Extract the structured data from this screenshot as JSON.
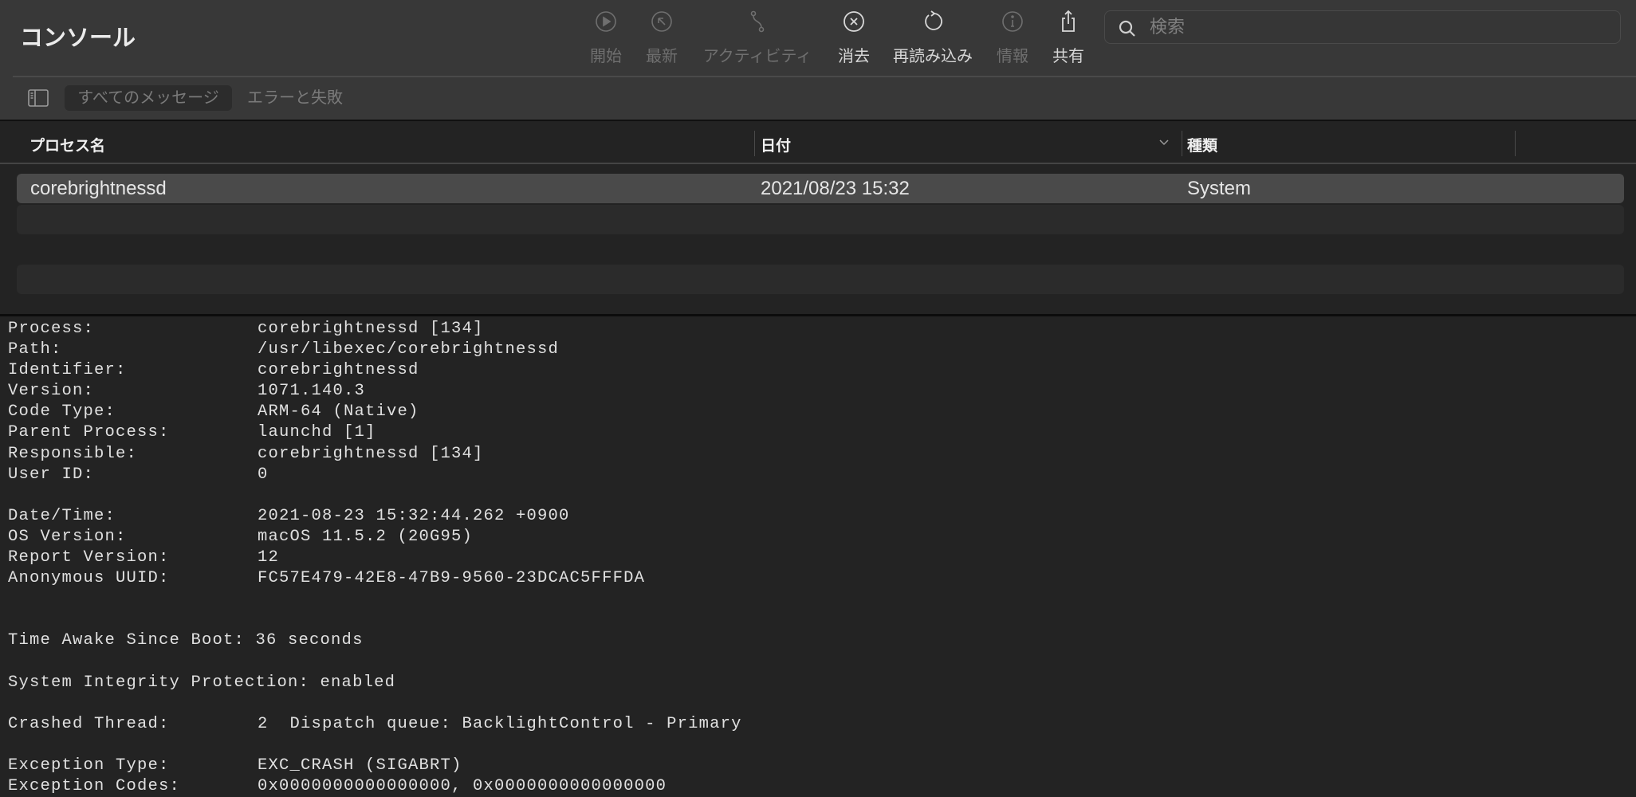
{
  "window": {
    "title": "コンソール"
  },
  "toolbar": {
    "buttons": [
      {
        "label": "開始",
        "icon": "play-circle-icon",
        "enabled": false
      },
      {
        "label": "最新",
        "icon": "arrow-up-left-circle-icon",
        "enabled": false
      },
      {
        "label": "アクティビティ",
        "icon": "activity-icon",
        "enabled": false
      },
      {
        "label": "消去",
        "icon": "clear-x-circle-icon",
        "enabled": true
      },
      {
        "label": "再読み込み",
        "icon": "reload-icon",
        "enabled": true
      },
      {
        "label": "情報",
        "icon": "info-icon",
        "enabled": false
      },
      {
        "label": "共有",
        "icon": "share-icon",
        "enabled": true
      }
    ],
    "search": {
      "placeholder": "検索",
      "value": ""
    }
  },
  "filters": {
    "all_messages": "すべてのメッセージ",
    "errors_faults": "エラーと失敗"
  },
  "table": {
    "columns": [
      "プロセス名",
      "日付",
      "種類"
    ],
    "rows": [
      {
        "process": "corebrightnessd",
        "date": "2021/08/23 15:32",
        "type": "System"
      }
    ]
  },
  "detail": {
    "lines": [
      {
        "k": "Process:",
        "v": "corebrightnessd [134]"
      },
      {
        "k": "Path:",
        "v": "/usr/libexec/corebrightnessd"
      },
      {
        "k": "Identifier:",
        "v": "corebrightnessd"
      },
      {
        "k": "Version:",
        "v": "1071.140.3"
      },
      {
        "k": "Code Type:",
        "v": "ARM-64 (Native)"
      },
      {
        "k": "Parent Process:",
        "v": "launchd [1]"
      },
      {
        "k": "Responsible:",
        "v": "corebrightnessd [134]"
      },
      {
        "k": "User ID:",
        "v": "0"
      },
      {
        "k": "",
        "v": ""
      },
      {
        "k": "Date/Time:",
        "v": "2021-08-23 15:32:44.262 +0900"
      },
      {
        "k": "OS Version:",
        "v": "macOS 11.5.2 (20G95)"
      },
      {
        "k": "Report Version:",
        "v": "12"
      },
      {
        "k": "Anonymous UUID:",
        "v": "FC57E479-42E8-47B9-9560-23DCAC5FFFDA"
      },
      {
        "k": "",
        "v": ""
      },
      {
        "k": "",
        "v": ""
      },
      {
        "raw": "Time Awake Since Boot: 36 seconds"
      },
      {
        "k": "",
        "v": ""
      },
      {
        "raw": "System Integrity Protection: enabled"
      },
      {
        "k": "",
        "v": ""
      },
      {
        "k": "Crashed Thread:",
        "v": "2  Dispatch queue: BacklightControl - Primary"
      },
      {
        "k": "",
        "v": ""
      },
      {
        "k": "Exception Type:",
        "v": "EXC_CRASH (SIGABRT)"
      },
      {
        "k": "Exception Codes:",
        "v": "0x0000000000000000, 0x0000000000000000"
      }
    ]
  }
}
